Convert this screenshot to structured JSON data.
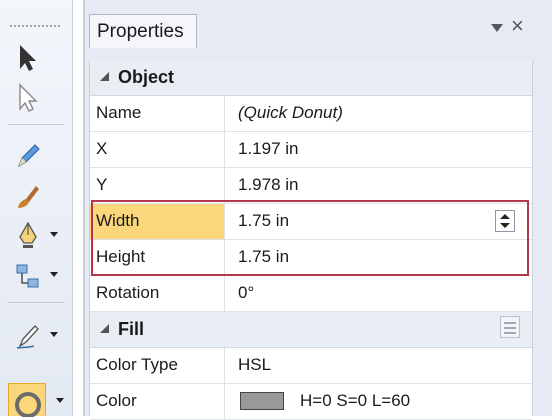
{
  "panel": {
    "tab_title": "Properties",
    "pin_icon": "dropdown-arrow-icon",
    "close_glyph": "×"
  },
  "categories": {
    "object": "Object",
    "fill": "Fill"
  },
  "properties": {
    "name": {
      "label": "Name",
      "value": "(Quick Donut)"
    },
    "x": {
      "label": "X",
      "value": "1.197 in"
    },
    "y": {
      "label": "Y",
      "value": "1.978 in"
    },
    "width": {
      "label": "Width",
      "value": "1.75 in"
    },
    "height": {
      "label": "Height",
      "value": "1.75 in"
    },
    "rotation": {
      "label": "Rotation",
      "value": "0°"
    },
    "color_type": {
      "label": "Color Type",
      "value": "HSL"
    },
    "color": {
      "label": "Color",
      "value": "H=0 S=0 L=60",
      "swatch": "#999999"
    }
  },
  "toolbar": {
    "tools": [
      "pointer-icon",
      "hollow-arrow-icon",
      "pencil-icon",
      "brush-icon",
      "pen-icon",
      "connector-icon",
      "line-pen-icon",
      "donut-shape-icon"
    ],
    "active_tool": "donut-shape-icon"
  },
  "colors": {
    "highlight": "#fbd67a",
    "selection_border": "#b3364c",
    "panel_bg": "#e6ebf3"
  }
}
